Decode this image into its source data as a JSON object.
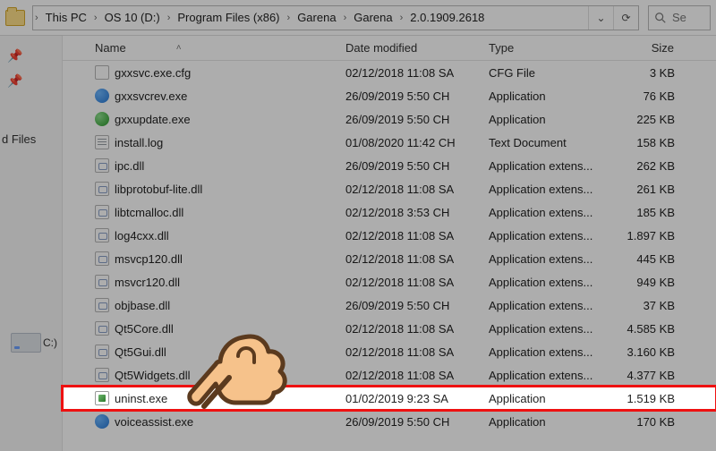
{
  "breadcrumb": [
    "This PC",
    "OS 10 (D:)",
    "Program Files (x86)",
    "Garena",
    "Garena",
    "2.0.1909.2618"
  ],
  "search_placeholder": "Se",
  "columns": {
    "name": "Name",
    "date": "Date modified",
    "type": "Type",
    "size": "Size"
  },
  "left": {
    "pinned_label": "d Files",
    "drive_label": "C:)"
  },
  "files": [
    {
      "icon": "cfg",
      "name": "gxxsvc.exe.cfg",
      "date": "02/12/2018 11:08 SA",
      "type": "CFG File",
      "size": "3 KB"
    },
    {
      "icon": "exe-blue",
      "name": "gxxsvcrev.exe",
      "date": "26/09/2019 5:50 CH",
      "type": "Application",
      "size": "76 KB"
    },
    {
      "icon": "exe-green",
      "name": "gxxupdate.exe",
      "date": "26/09/2019 5:50 CH",
      "type": "Application",
      "size": "225 KB"
    },
    {
      "icon": "txt",
      "name": "install.log",
      "date": "01/08/2020 11:42 CH",
      "type": "Text Document",
      "size": "158 KB"
    },
    {
      "icon": "dll",
      "name": "ipc.dll",
      "date": "26/09/2019 5:50 CH",
      "type": "Application extens...",
      "size": "262 KB"
    },
    {
      "icon": "dll",
      "name": "libprotobuf-lite.dll",
      "date": "02/12/2018 11:08 SA",
      "type": "Application extens...",
      "size": "261 KB"
    },
    {
      "icon": "dll",
      "name": "libtcmalloc.dll",
      "date": "02/12/2018 3:53 CH",
      "type": "Application extens...",
      "size": "185 KB"
    },
    {
      "icon": "dll",
      "name": "log4cxx.dll",
      "date": "02/12/2018 11:08 SA",
      "type": "Application extens...",
      "size": "1.897 KB"
    },
    {
      "icon": "dll",
      "name": "msvcp120.dll",
      "date": "02/12/2018 11:08 SA",
      "type": "Application extens...",
      "size": "445 KB"
    },
    {
      "icon": "dll",
      "name": "msvcr120.dll",
      "date": "02/12/2018 11:08 SA",
      "type": "Application extens...",
      "size": "949 KB"
    },
    {
      "icon": "dll",
      "name": "objbase.dll",
      "date": "26/09/2019 5:50 CH",
      "type": "Application extens...",
      "size": "37 KB"
    },
    {
      "icon": "dll",
      "name": "Qt5Core.dll",
      "date": "02/12/2018 11:08 SA",
      "type": "Application extens...",
      "size": "4.585 KB"
    },
    {
      "icon": "dll",
      "name": "Qt5Gui.dll",
      "date": "02/12/2018 11:08 SA",
      "type": "Application extens...",
      "size": "3.160 KB"
    },
    {
      "icon": "dll",
      "name": "Qt5Widgets.dll",
      "date": "02/12/2018 11:08 SA",
      "type": "Application extens...",
      "size": "4.377 KB"
    },
    {
      "icon": "exe-unin",
      "name": "uninst.exe",
      "date": "01/02/2019 9:23 SA",
      "type": "Application",
      "size": "1.519 KB",
      "highlight": true
    },
    {
      "icon": "exe-blue",
      "name": "voiceassist.exe",
      "date": "26/09/2019 5:50 CH",
      "type": "Application",
      "size": "170 KB"
    }
  ]
}
